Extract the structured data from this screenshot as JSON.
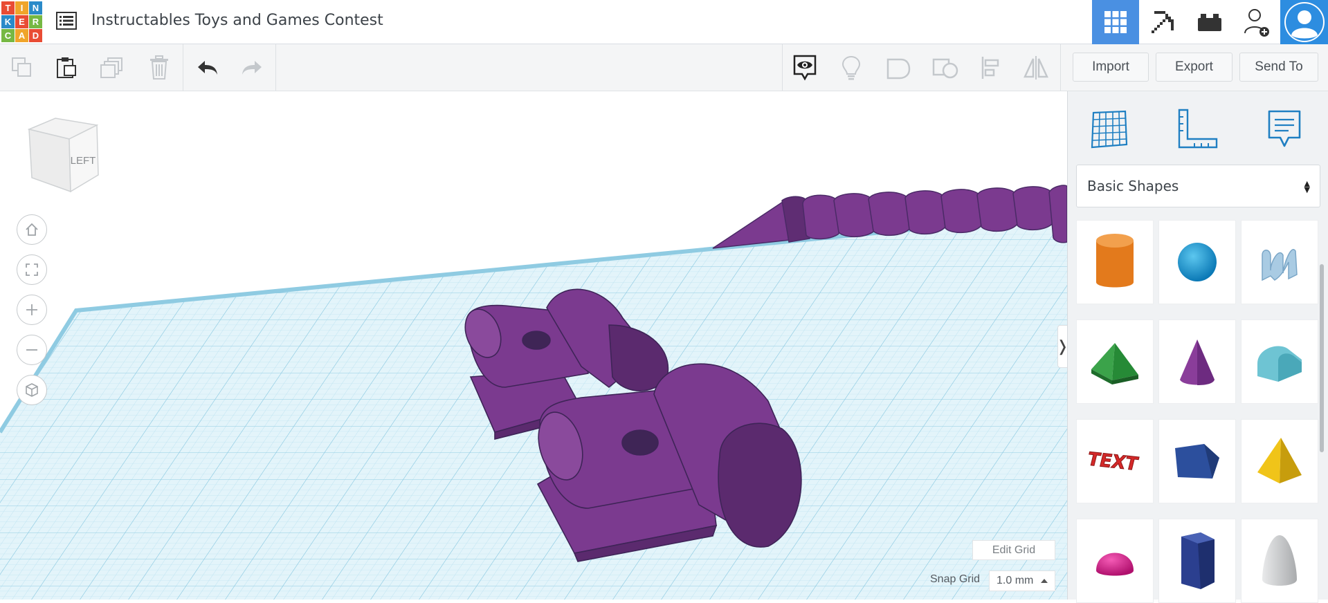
{
  "header": {
    "logo_letters": [
      "T",
      "I",
      "N",
      "K",
      "E",
      "R",
      "C",
      "A",
      "D"
    ],
    "logo_colors": [
      "#e94c34",
      "#f0a52a",
      "#2a8ac9",
      "#2a8ac9",
      "#e94c34",
      "#76b843",
      "#76b843",
      "#f0a52a",
      "#e94c34"
    ],
    "title": "Instructables Toys and Games Contest",
    "icons": {
      "list": "list-icon",
      "grid_view": "grid-view-icon",
      "pickaxe": "pickaxe-icon",
      "blocks": "brick-icon",
      "invite": "add-user-icon",
      "avatar": "avatar-icon"
    },
    "accent": "#4a90e2"
  },
  "toolbar": {
    "import_label": "Import",
    "export_label": "Export",
    "send_to_label": "Send To"
  },
  "viewport": {
    "view_cube_face": "LEFT",
    "edit_grid_label": "Edit Grid",
    "snap_grid_label": "Snap Grid",
    "snap_grid_value": "1.0 mm",
    "collapse_glyph": "❭",
    "model_color": "#7b3a8f",
    "grid_color": "#a8dcef"
  },
  "panel": {
    "library_selected": "Basic Shapes",
    "shapes": [
      {
        "name": "cylinder",
        "color": "#e37a1c"
      },
      {
        "name": "sphere",
        "color": "#1fa0d9"
      },
      {
        "name": "scribble",
        "color": "#9cc1dd"
      },
      {
        "name": "roof",
        "color": "#3ba34a"
      },
      {
        "name": "cone",
        "color": "#8a3d9a"
      },
      {
        "name": "round-roof",
        "color": "#6ec4d3"
      },
      {
        "name": "text",
        "color": "#d42929"
      },
      {
        "name": "box-prism",
        "color": "#2c4f9d"
      },
      {
        "name": "pyramid",
        "color": "#f0c419"
      },
      {
        "name": "half-sphere",
        "color": "#e0168b"
      },
      {
        "name": "polygon",
        "color": "#2b3f8f"
      },
      {
        "name": "paraboloid",
        "color": "#c9cbcd"
      }
    ],
    "text_shape_label": "TEXT"
  }
}
